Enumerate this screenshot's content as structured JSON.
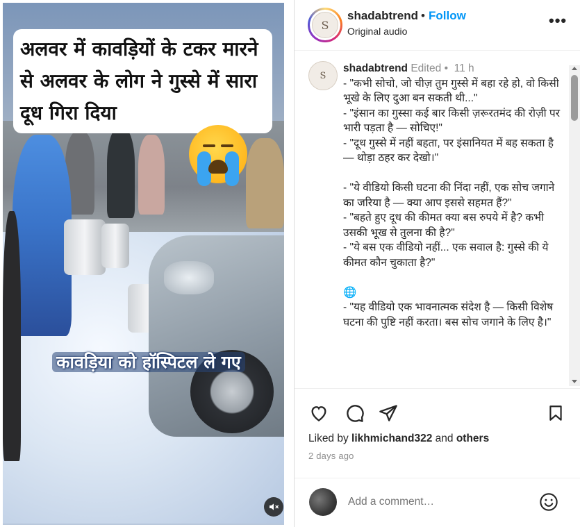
{
  "video": {
    "headline": "अलवर में कावड़ियों के टकर मारने से अलवर के लोग ने गुस्से में सारा दूध गिरा दिया",
    "subtitle": "कावड़िया को हॉस्पिटल ले गए",
    "mute_icon": "speaker-muted-icon"
  },
  "header": {
    "username": "shadabtrend",
    "separator": "•",
    "follow_label": "Follow",
    "audio_label": "Original audio",
    "avatar_letter": "S",
    "more_icon": "•••"
  },
  "caption": {
    "username": "shadabtrend",
    "meta": "Edited •  11 h",
    "avatar_letter": "S",
    "body": "- \"कभी सोचो, जो चीज़ तुम गुस्से में बहा रहे हो, वो किसी भूखे के लिए दुआ बन सकती थी...\"\n- \"इंसान का गुस्सा कई बार किसी ज़रूरतमंद की रोज़ी पर भारी पड़ता है — सोचिए!\"\n- \"दूध गुस्से में नहीं बहता, पर इंसानियत में बह सकता है — थोड़ा ठहर कर देखो।\"\n\n- \"ये वीडियो किसी घटना की निंदा नहीं, एक सोच जगाने का जरिया है — क्या आप इससे सहमत हैं?\"\n- \"बहते हुए दूध की कीमत क्या बस रुपये में है? कभी उसकी भूख से तुलना की है?\"\n- \"ये बस एक वीडियो नहीं... एक सवाल है: गुस्से की ये कीमत कौन चुकाता है?\"\n\n🌐\n- \"यह वीडियो एक भावनात्मक संदेश है — किसी विशेष घटना की पुष्टि नहीं करता। बस सोच जगाने के लिए है।\""
  },
  "actions": {
    "liked_prefix": "Liked by ",
    "liked_user": "likhmichand322",
    "liked_and": " and ",
    "liked_others": "others",
    "date": "2 days ago"
  },
  "comment": {
    "placeholder": "Add a comment…"
  }
}
